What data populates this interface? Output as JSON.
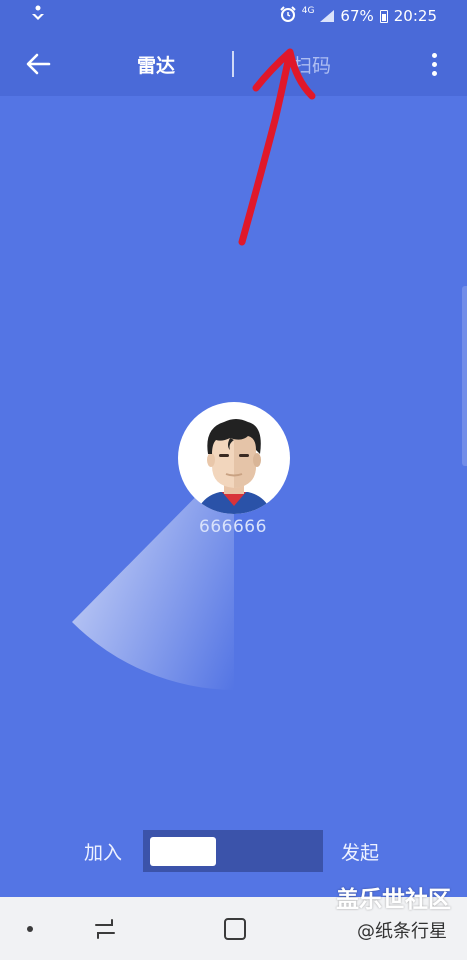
{
  "status_bar": {
    "network": "4G",
    "battery": "67%",
    "time": "20:25",
    "icons": [
      "download-notification-icon",
      "alarm-icon",
      "signal-icon",
      "battery-icon"
    ]
  },
  "toolbar": {
    "back_icon": "arrow-left-icon",
    "tabs": [
      {
        "label": "雷达",
        "active": true
      },
      {
        "label": "扫码",
        "active": false
      }
    ],
    "more_icon": "more-vertical-icon"
  },
  "radar": {
    "username": "666666",
    "avatar": "superman-avatar"
  },
  "mode_toggle": {
    "left_label": "加入",
    "right_label": "发起",
    "knob_position": "left"
  },
  "watermark": {
    "main": "盖乐世社区",
    "sub": "@纸条行星"
  },
  "nav_bar": {
    "icons": [
      "nav-dot-icon",
      "recent-apps-icon",
      "home-icon"
    ]
  },
  "colors": {
    "background": "#5475e4",
    "toolbar": "#4a6ad8",
    "toggle_track": "#3b53aa",
    "annotation": "#e0182a"
  }
}
